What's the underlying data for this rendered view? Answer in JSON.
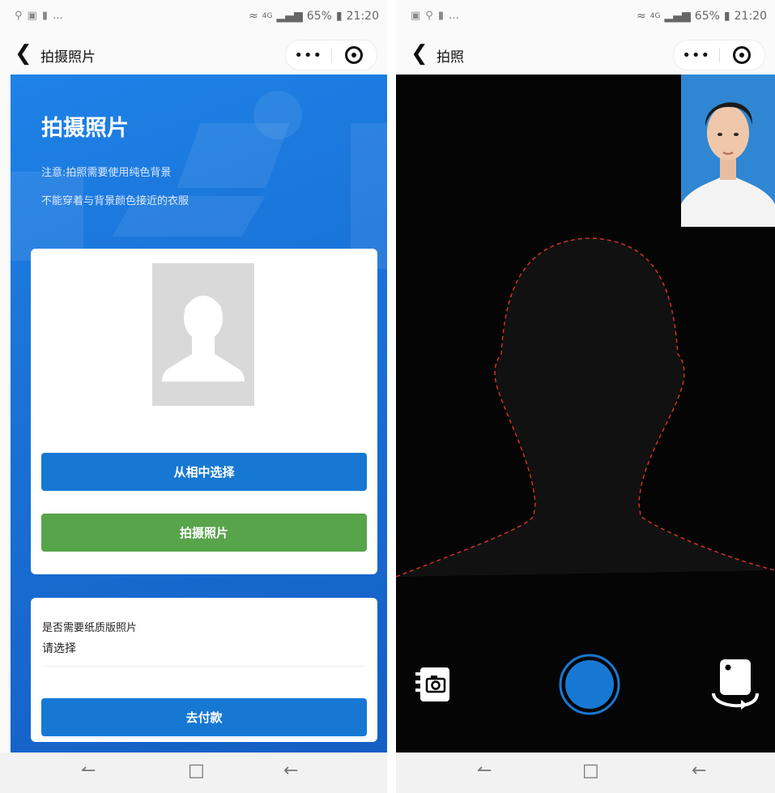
{
  "left": {
    "statusbar": {
      "left_glyphs": "…",
      "signal": "4G",
      "battery": "65%",
      "time": "21:20"
    },
    "navbar": {
      "title": "拍摄照片",
      "menu_dots": "•••"
    },
    "hero": {
      "heading": "拍摄照片",
      "note_line1": "注意:拍照需要使用纯色背景",
      "note_line2": "不能穿着与背景颜色接近的衣服"
    },
    "buttons": {
      "choose_from_album": "从相中选择",
      "take_photo": "拍摄照片"
    },
    "paper": {
      "label": "是否需要纸质版照片",
      "value": "请选择",
      "pay_button": "去付款"
    }
  },
  "right": {
    "statusbar": {
      "left_glyphs": "…",
      "signal": "4G",
      "battery": "65%",
      "time": "21:20"
    },
    "navbar": {
      "title": "拍照",
      "menu_dots": "•••"
    }
  },
  "colors": {
    "primary_blue": "#1778d4",
    "green": "#57a44a",
    "guide_red": "#d9332f",
    "id_photo_bg": "#2f86d2"
  },
  "icons": {
    "gallery": "album-icon",
    "shutter": "shutter-button",
    "flip": "switch-camera-icon"
  }
}
